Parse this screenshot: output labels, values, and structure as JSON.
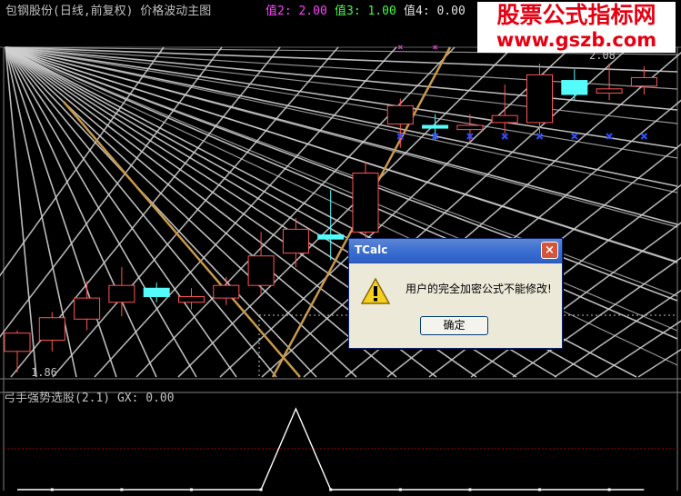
{
  "header": {
    "title": "包钢股份(日线,前复权) 价格波动主图",
    "value2": "值2: 2.00",
    "value3": "值3: 1.00",
    "value4": "值4: 0.00"
  },
  "watermark": {
    "text_cn": "股票公式指标网",
    "url": "www.gszb.com"
  },
  "chart_data": {
    "type": "candlestick",
    "price_labels": {
      "high": "2.08",
      "low": "1.86"
    },
    "candles": [
      {
        "open": 1.875,
        "close": 1.888,
        "high": 1.89,
        "low": 1.86,
        "color": "red"
      },
      {
        "open": 1.883,
        "close": 1.899,
        "high": 1.903,
        "low": 1.875,
        "color": "red"
      },
      {
        "open": 1.898,
        "close": 1.913,
        "high": 1.925,
        "low": 1.89,
        "color": "red"
      },
      {
        "open": 1.91,
        "close": 1.922,
        "high": 1.935,
        "low": 1.9,
        "color": "red"
      },
      {
        "open": 1.92,
        "close": 1.914,
        "high": 1.924,
        "low": 1.91,
        "color": "cyan"
      },
      {
        "open": 1.91,
        "close": 1.914,
        "high": 1.92,
        "low": 1.905,
        "color": "red"
      },
      {
        "open": 1.913,
        "close": 1.922,
        "high": 1.928,
        "low": 1.908,
        "color": "red"
      },
      {
        "open": 1.922,
        "close": 1.943,
        "high": 1.96,
        "low": 1.915,
        "color": "red"
      },
      {
        "open": 1.945,
        "close": 1.962,
        "high": 1.97,
        "low": 1.935,
        "color": "red"
      },
      {
        "open": 1.955,
        "close": 1.958,
        "high": 1.99,
        "low": 1.94,
        "color": "cyan"
      },
      {
        "open": 1.96,
        "close": 2.002,
        "high": 2.01,
        "low": 1.955,
        "color": "red"
      },
      {
        "open": 2.037,
        "close": 2.05,
        "high": 2.055,
        "low": 2.02,
        "color": "red"
      },
      {
        "open": 2.036,
        "close": 2.034,
        "high": 2.044,
        "low": 2.026,
        "color": "cyan"
      },
      {
        "open": 2.033,
        "close": 2.036,
        "high": 2.044,
        "low": 2.024,
        "color": "red"
      },
      {
        "open": 2.038,
        "close": 2.043,
        "high": 2.065,
        "low": 2.03,
        "color": "red"
      },
      {
        "open": 2.038,
        "close": 2.072,
        "high": 2.08,
        "low": 2.03,
        "color": "red"
      },
      {
        "open": 2.058,
        "close": 2.068,
        "high": 2.076,
        "low": 2.054,
        "color": "cyan"
      },
      {
        "open": 2.059,
        "close": 2.062,
        "high": 2.08,
        "low": 2.054,
        "color": "red"
      },
      {
        "open": 2.064,
        "close": 2.07,
        "high": 2.078,
        "low": 2.058,
        "color": "red"
      }
    ],
    "blue_markers_start": 11,
    "grid_color": "#d0d0d0",
    "gold_color": "#c89a4a"
  },
  "sub_chart": {
    "label": "弓手强势选股(2.1) GX: 0.00",
    "signal_values": [
      0,
      0,
      0,
      0,
      0,
      0,
      0,
      0,
      1,
      0,
      0,
      0,
      0,
      0,
      0,
      0,
      0,
      0,
      0
    ]
  },
  "dialog": {
    "title": "TCalc",
    "close": "×",
    "message": "用户的完全加密公式不能修改!",
    "ok": "确定"
  }
}
